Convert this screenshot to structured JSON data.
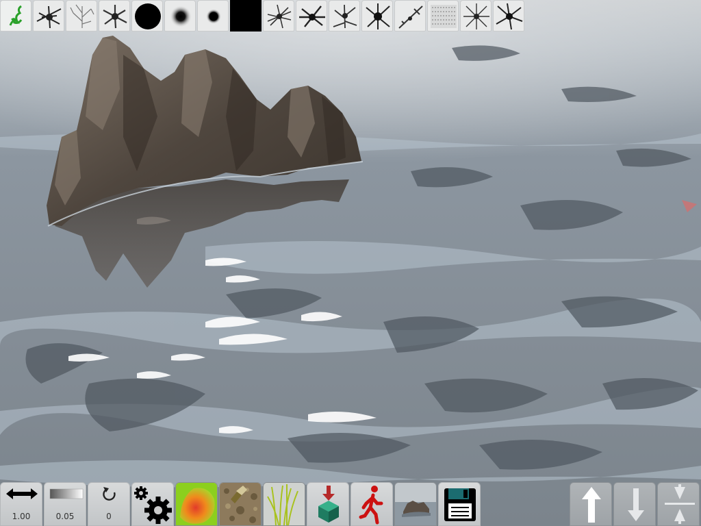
{
  "app": {
    "screen": "terrain-editor-water-view"
  },
  "top_toolbar": {
    "brushes": [
      {
        "name": "brush-green-scribble",
        "selected": true
      },
      {
        "name": "brush-splatter-1"
      },
      {
        "name": "brush-branches"
      },
      {
        "name": "brush-star"
      },
      {
        "name": "brush-hard-round"
      },
      {
        "name": "brush-soft-round"
      },
      {
        "name": "brush-small-round"
      },
      {
        "name": "brush-solid-square"
      },
      {
        "name": "brush-splatter-2"
      },
      {
        "name": "brush-splatter-3"
      },
      {
        "name": "brush-splatter-4"
      },
      {
        "name": "brush-splatter-5"
      },
      {
        "name": "brush-streak"
      },
      {
        "name": "brush-noise"
      },
      {
        "name": "brush-splatter-6"
      },
      {
        "name": "brush-splatter-7"
      }
    ]
  },
  "bottom_toolbar": {
    "size": {
      "icon": "double-arrow-icon",
      "value": "1.00"
    },
    "opacity": {
      "icon": "gradient-bar-icon",
      "value": "0.05"
    },
    "rotation": {
      "icon": "rotate-icon",
      "value": "0"
    },
    "settings": {
      "icon": "gear-icon"
    },
    "tools": [
      "heightmap-paint-tool",
      "texture-paint-tool",
      "grass-tool",
      "place-object-tool",
      "walk-mode-tool",
      "terrain-view-tool",
      "save-tool"
    ],
    "actions": [
      "raise-terrain-arrow-up",
      "lower-terrain-arrow-down",
      "flatten-terrain"
    ]
  },
  "colors": {
    "toolbar_bg": "#d6d8d9",
    "water": "#7e8a94",
    "rock": "#5f554b",
    "walk_icon": "#cc1111",
    "box_green": "#1f8a6a",
    "box_arrow": "#b52a2a"
  }
}
